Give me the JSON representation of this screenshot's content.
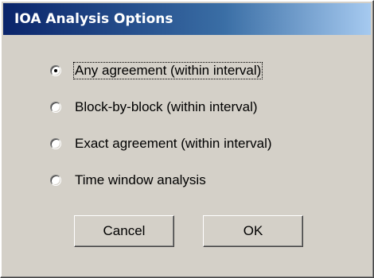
{
  "window": {
    "title": "IOA Analysis Options"
  },
  "options": [
    {
      "label": "Any agreement (within interval)",
      "selected": true
    },
    {
      "label": "Block-by-block (within interval)",
      "selected": false
    },
    {
      "label": "Exact agreement (within interval)",
      "selected": false
    },
    {
      "label": "Time window analysis",
      "selected": false
    }
  ],
  "buttons": {
    "cancel_label": "Cancel",
    "ok_label": "OK"
  },
  "colors": {
    "title_bar_start": "#0a246a",
    "title_bar_end": "#a6caf0",
    "dialog_face": "#d4d0c8"
  }
}
